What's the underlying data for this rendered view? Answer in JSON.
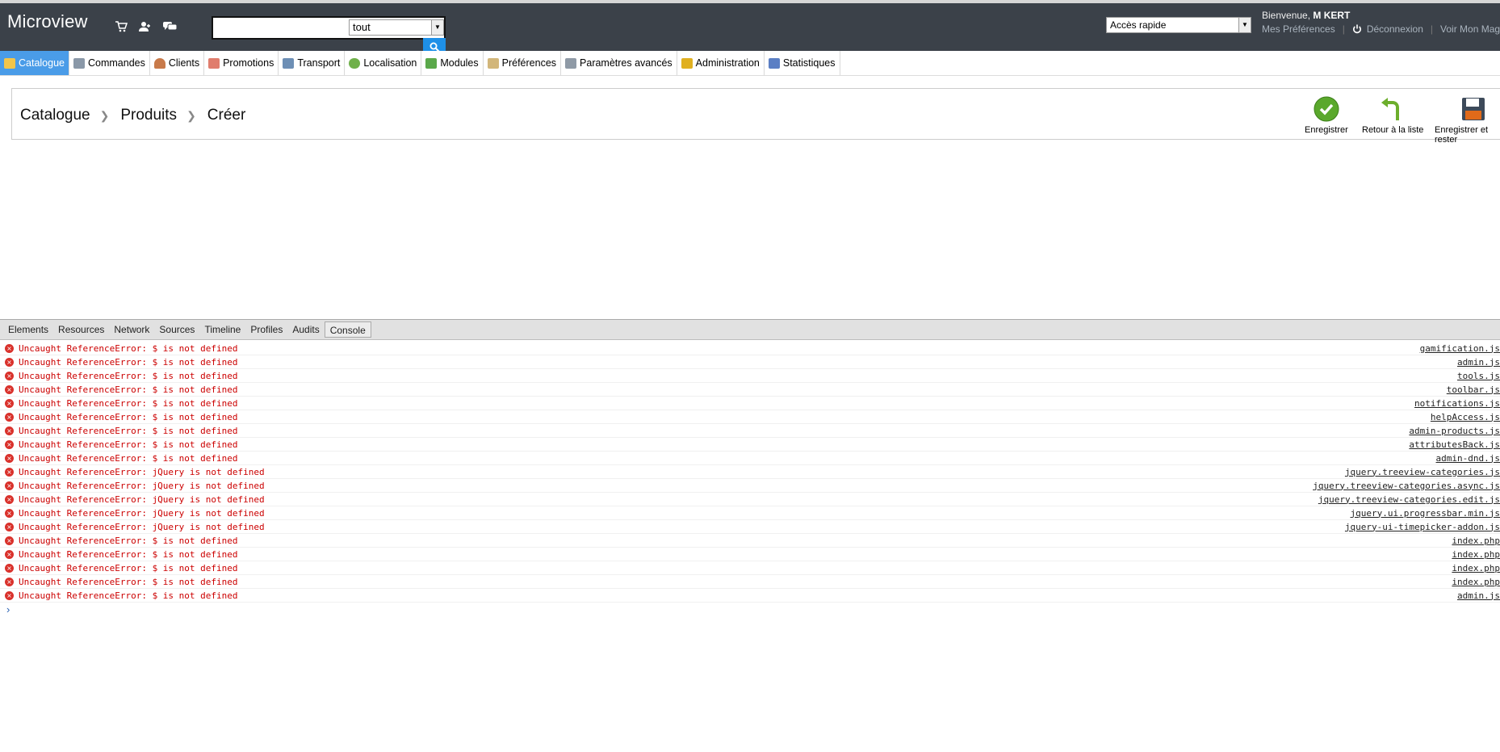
{
  "header": {
    "logo": "Microview",
    "search_value": "",
    "search_scope": "tout",
    "quick_access": "Accès rapide",
    "welcome_prefix": "Bienvenue, ",
    "user_name": "M KERT",
    "prefs_link": "Mes Préférences",
    "logout_link": "Déconnexion",
    "shop_link": "Voir Mon Magasin"
  },
  "menu": {
    "items": [
      {
        "label": "Catalogue"
      },
      {
        "label": "Commandes"
      },
      {
        "label": "Clients"
      },
      {
        "label": "Promotions"
      },
      {
        "label": "Transport"
      },
      {
        "label": "Localisation"
      },
      {
        "label": "Modules"
      },
      {
        "label": "Préférences"
      },
      {
        "label": "Paramètres avancés"
      },
      {
        "label": "Administration"
      },
      {
        "label": "Statistiques"
      }
    ]
  },
  "breadcrumb": {
    "level1": "Catalogue",
    "level2": "Produits",
    "level3": "Créer"
  },
  "toolbar": {
    "save_label": "Enregistrer",
    "back_label": "Retour à la liste",
    "save_stay_label": "Enregistrer et rester"
  },
  "devtools": {
    "tabs": [
      "Elements",
      "Resources",
      "Network",
      "Sources",
      "Timeline",
      "Profiles",
      "Audits",
      "Console"
    ],
    "active_tab": "Console",
    "errors": [
      {
        "message": "Uncaught ReferenceError: $ is not defined",
        "source": "gamification.js"
      },
      {
        "message": "Uncaught ReferenceError: $ is not defined",
        "source": "admin.js"
      },
      {
        "message": "Uncaught ReferenceError: $ is not defined",
        "source": "tools.js"
      },
      {
        "message": "Uncaught ReferenceError: $ is not defined",
        "source": "toolbar.js"
      },
      {
        "message": "Uncaught ReferenceError: $ is not defined",
        "source": "notifications.js"
      },
      {
        "message": "Uncaught ReferenceError: $ is not defined",
        "source": "helpAccess.js"
      },
      {
        "message": "Uncaught ReferenceError: $ is not defined",
        "source": "admin-products.js"
      },
      {
        "message": "Uncaught ReferenceError: $ is not defined",
        "source": "attributesBack.js"
      },
      {
        "message": "Uncaught ReferenceError: $ is not defined",
        "source": "admin-dnd.js"
      },
      {
        "message": "Uncaught ReferenceError: jQuery is not defined",
        "source": "jquery.treeview-categories.js"
      },
      {
        "message": "Uncaught ReferenceError: jQuery is not defined",
        "source": "jquery.treeview-categories.async.js"
      },
      {
        "message": "Uncaught ReferenceError: jQuery is not defined",
        "source": "jquery.treeview-categories.edit.js"
      },
      {
        "message": "Uncaught ReferenceError: jQuery is not defined",
        "source": "jquery.ui.progressbar.min.js"
      },
      {
        "message": "Uncaught ReferenceError: jQuery is not defined",
        "source": "jquery-ui-timepicker-addon.js"
      },
      {
        "message": "Uncaught ReferenceError: $ is not defined",
        "source": "index.php"
      },
      {
        "message": "Uncaught ReferenceError: $ is not defined",
        "source": "index.php"
      },
      {
        "message": "Uncaught ReferenceError: $ is not defined",
        "source": "index.php"
      },
      {
        "message": "Uncaught ReferenceError: $ is not defined",
        "source": "index.php"
      },
      {
        "message": "Uncaught ReferenceError: $ is not defined",
        "source": "admin.js"
      }
    ]
  }
}
